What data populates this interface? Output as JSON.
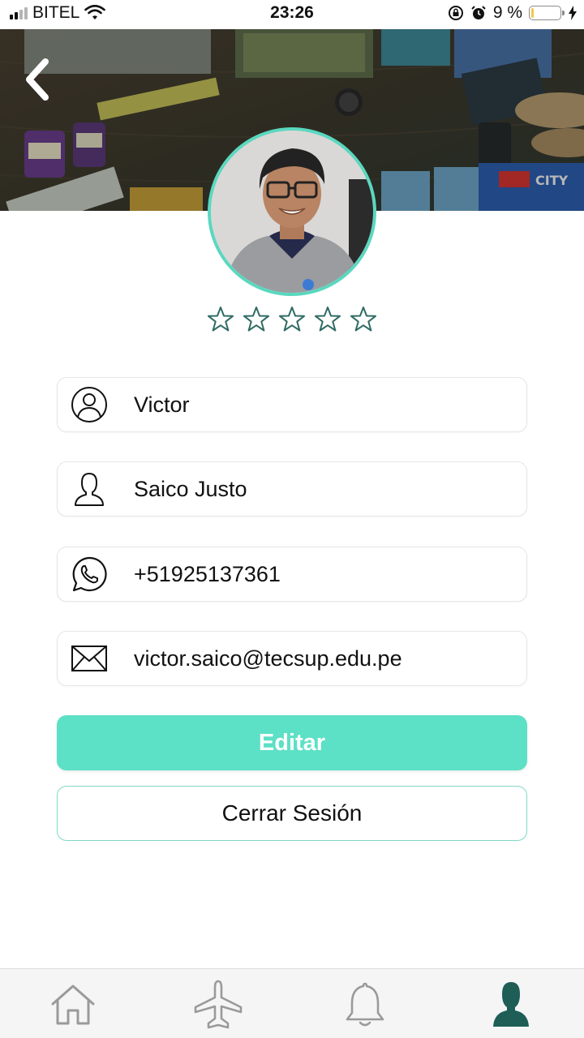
{
  "status_bar": {
    "carrier": "BITEL",
    "time": "23:26",
    "battery_percent": "9 %",
    "battery_level": 0.09,
    "signal_bars_active": 2,
    "icons": [
      "signal-icon",
      "wifi-icon",
      "orientation-lock-icon",
      "alarm-icon",
      "battery-icon",
      "charging-bolt-icon"
    ]
  },
  "header": {
    "back_icon": "chevron-left-icon"
  },
  "profile": {
    "rating": 0,
    "rating_max": 5,
    "fields": [
      {
        "name": "first-name",
        "icon": "user-circle-icon",
        "value": "Victor"
      },
      {
        "name": "last-name",
        "icon": "user-outline-icon",
        "value": "Saico Justo"
      },
      {
        "name": "phone",
        "icon": "whatsapp-icon",
        "value": "+51925137361"
      },
      {
        "name": "email",
        "icon": "envelope-icon",
        "value": "victor.saico@tecsup.edu.pe"
      }
    ]
  },
  "actions": {
    "edit_label": "Editar",
    "logout_label": "Cerrar Sesión"
  },
  "tab_bar": {
    "tabs": [
      {
        "icon": "home-icon",
        "active": false
      },
      {
        "icon": "airplane-icon",
        "active": false
      },
      {
        "icon": "bell-icon",
        "active": false
      },
      {
        "icon": "profile-icon",
        "active": true
      }
    ]
  },
  "colors": {
    "accent": "#5ce0c6",
    "avatar_border": "#5ad8bf",
    "star_outline": "#2f6b63",
    "active_tab": "#1f5d57",
    "inactive_tab": "#9a9a9a"
  }
}
